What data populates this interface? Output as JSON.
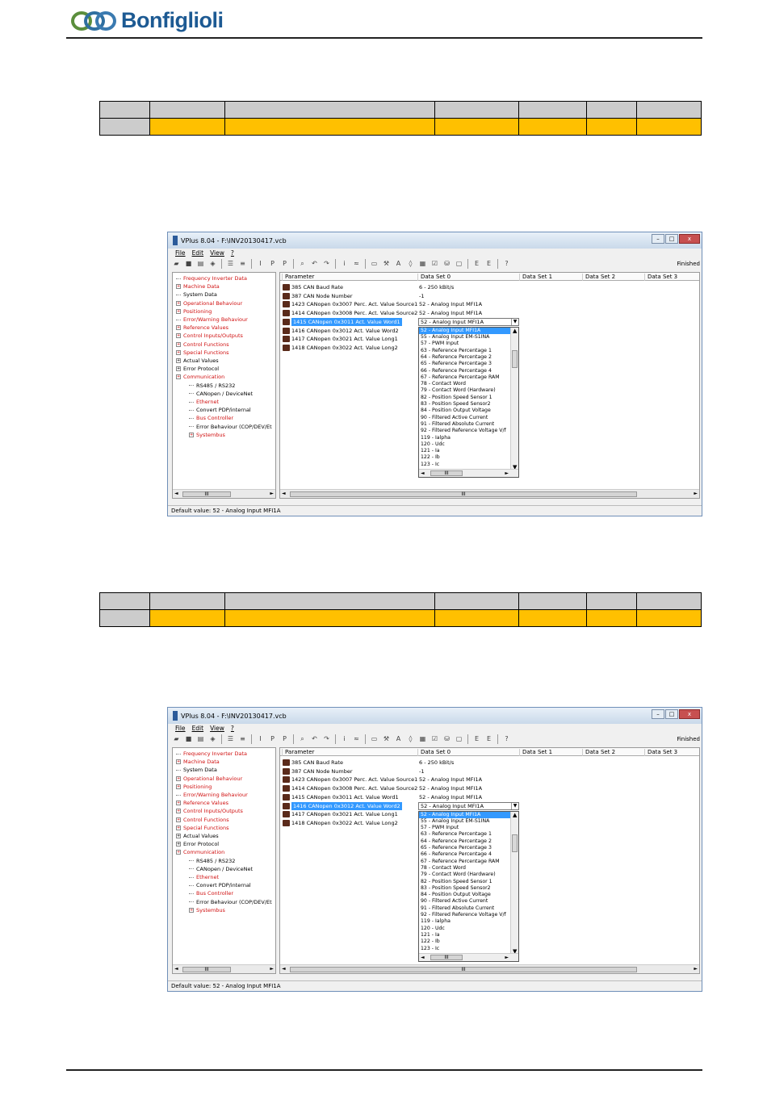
{
  "brand": {
    "name": "Bonfiglioli",
    "colors": {
      "brand": "#1d5a93",
      "highlight": "#ffc000",
      "tableHeader": "#cccccc",
      "red": "#d01010",
      "selection": "#3399ff"
    }
  },
  "screens": [
    {
      "title": "VPlus 8.04 - F:\\INV20130417.vcb",
      "menu": [
        "File",
        "Edit",
        "View",
        "?"
      ],
      "status_right": "Finished",
      "tree": [
        {
          "label": "Frequency Inverter Data",
          "red": true,
          "exp": false
        },
        {
          "label": "Machine Data",
          "red": true,
          "exp": true
        },
        {
          "label": "System Data",
          "red": false,
          "exp": false
        },
        {
          "label": "Operational Behaviour",
          "red": true,
          "exp": true
        },
        {
          "label": "Positioning",
          "red": true,
          "exp": true
        },
        {
          "label": "Error/Warning Behaviour",
          "red": true,
          "exp": false
        },
        {
          "label": "Reference Values",
          "red": true,
          "exp": true
        },
        {
          "label": "Control Inputs/Outputs",
          "red": true,
          "exp": true
        },
        {
          "label": "Control Functions",
          "red": true,
          "exp": true
        },
        {
          "label": "Special Functions",
          "red": true,
          "exp": true
        },
        {
          "label": "Actual Values",
          "red": false,
          "exp": true
        },
        {
          "label": "Error Protocol",
          "red": false,
          "exp": true
        },
        {
          "label": "Communication",
          "red": true,
          "exp": true
        },
        {
          "label": "RS485 / RS232",
          "red": false,
          "exp": false,
          "child": true
        },
        {
          "label": "CANopen / DeviceNet",
          "red": false,
          "exp": false,
          "child": true
        },
        {
          "label": "Ethernet",
          "red": true,
          "exp": false,
          "child": true
        },
        {
          "label": "Convert PDP/internal",
          "red": false,
          "exp": false,
          "child": true
        },
        {
          "label": "Bus Controller",
          "red": true,
          "exp": false,
          "child": true
        },
        {
          "label": "Error Behaviour (COP/DEV/Et",
          "red": false,
          "exp": false,
          "child": true
        },
        {
          "label": "Systembus",
          "red": true,
          "exp": true,
          "child": true
        }
      ],
      "columns": [
        "Parameter",
        "Data Set 0",
        "Data Set 1",
        "Data Set 2",
        "Data Set 3"
      ],
      "rows": [
        {
          "name": "385  CAN Baud Rate",
          "value": "6 - 250 kBit/s"
        },
        {
          "name": "387  CAN Node Number",
          "value": "-1"
        },
        {
          "name": "1423  CANopen 0x3007 Perc. Act. Value Source1",
          "value": "52 - Analog Input MFI1A"
        },
        {
          "name": "1414  CANopen 0x3008 Perc. Act. Value Source2",
          "value": "52 - Analog Input MFI1A"
        },
        {
          "name": "1415  CANopen 0x3011 Act. Value Word1",
          "value": "",
          "selected": true,
          "combo": true
        },
        {
          "name": "1416  CANopen 0x3012 Act. Value Word2",
          "value": ""
        },
        {
          "name": "1417  CANopen 0x3021 Act. Value Long1",
          "value": ""
        },
        {
          "name": "1418  CANopen 0x3022 Act. Value Long2",
          "value": ""
        }
      ],
      "combo_value": "52 - Analog Input MFI1A",
      "status": "Default value: 52 - Analog Input MFI1A"
    },
    {
      "title": "VPlus 8.04 - F:\\INV20130417.vcb",
      "menu": [
        "File",
        "Edit",
        "View",
        "?"
      ],
      "status_right": "Finished",
      "tree": [
        {
          "label": "Frequency Inverter Data",
          "red": true,
          "exp": false
        },
        {
          "label": "Machine Data",
          "red": true,
          "exp": true
        },
        {
          "label": "System Data",
          "red": false,
          "exp": false
        },
        {
          "label": "Operational Behaviour",
          "red": true,
          "exp": true
        },
        {
          "label": "Positioning",
          "red": true,
          "exp": true
        },
        {
          "label": "Error/Warning Behaviour",
          "red": true,
          "exp": false
        },
        {
          "label": "Reference Values",
          "red": true,
          "exp": true
        },
        {
          "label": "Control Inputs/Outputs",
          "red": true,
          "exp": true
        },
        {
          "label": "Control Functions",
          "red": true,
          "exp": true
        },
        {
          "label": "Special Functions",
          "red": true,
          "exp": true
        },
        {
          "label": "Actual Values",
          "red": false,
          "exp": true
        },
        {
          "label": "Error Protocol",
          "red": false,
          "exp": true
        },
        {
          "label": "Communication",
          "red": true,
          "exp": true
        },
        {
          "label": "RS485 / RS232",
          "red": false,
          "exp": false,
          "child": true
        },
        {
          "label": "CANopen / DeviceNet",
          "red": false,
          "exp": false,
          "child": true
        },
        {
          "label": "Ethernet",
          "red": true,
          "exp": false,
          "child": true
        },
        {
          "label": "Convert PDP/internal",
          "red": false,
          "exp": false,
          "child": true
        },
        {
          "label": "Bus Controller",
          "red": true,
          "exp": false,
          "child": true
        },
        {
          "label": "Error Behaviour (COP/DEV/Et",
          "red": false,
          "exp": false,
          "child": true
        },
        {
          "label": "Systembus",
          "red": true,
          "exp": true,
          "child": true
        }
      ],
      "columns": [
        "Parameter",
        "Data Set 0",
        "Data Set 1",
        "Data Set 2",
        "Data Set 3"
      ],
      "rows": [
        {
          "name": "385  CAN Baud Rate",
          "value": "6 - 250 kBit/s"
        },
        {
          "name": "387  CAN Node Number",
          "value": "-1"
        },
        {
          "name": "1423  CANopen 0x3007 Perc. Act. Value Source1",
          "value": "52 - Analog Input MFI1A"
        },
        {
          "name": "1414  CANopen 0x3008 Perc. Act. Value Source2",
          "value": "52 - Analog Input MFI1A"
        },
        {
          "name": "1415  CANopen 0x3011 Act. Value Word1",
          "value": "52 - Analog Input MFI1A"
        },
        {
          "name": "1416  CANopen 0x3012 Act. Value Word2",
          "value": "",
          "selected": true,
          "combo": true
        },
        {
          "name": "1417  CANopen 0x3021 Act. Value Long1",
          "value": ""
        },
        {
          "name": "1418  CANopen 0x3022 Act. Value Long2",
          "value": ""
        }
      ],
      "combo_value": "52 - Analog Input MFI1A",
      "status": "Default value: 52 - Analog Input MFI1A"
    }
  ],
  "dropdown_options": [
    "52 - Analog Input MFI1A",
    "55 - Analog Input EM-S1INA",
    "57 - PWM Input",
    "63 - Reference Percentage 1",
    "64 - Reference Percentage 2",
    "65 - Reference Percentage 3",
    "66 - Reference Percentage 4",
    "67 - Reference Percentage RAM",
    "78 - Contact Word",
    "79 - Contact Word (Hardware)",
    "82 - Position Speed Sensor 1",
    "83 - Position Speed Sensor2",
    "84 - Position Output Voltage",
    "90 - Filtered Active Current",
    "91 - Filtered Absolute Current",
    "92 - Filtered Reference Voltage V/f",
    "119 - Ialpha",
    "120 - Udc",
    "121 - Ia",
    "122 - Ib",
    "123 - Ic"
  ],
  "scroll_label": "III",
  "window_buttons": {
    "min": "–",
    "max": "□",
    "close": "x"
  },
  "icons": {
    "expand": "+",
    "collapse": "-",
    "dropdown": "▼",
    "left": "◄",
    "right": "►",
    "up": "▲",
    "down": "▼"
  },
  "toolbar_icons": [
    "open-icon",
    "save-icon",
    "print-icon",
    "find-icon",
    "sep",
    "tree-view-icon",
    "list-view-icon",
    "sep",
    "insert-icon",
    "add-icon",
    "remove-icon",
    "sep",
    "search-icon",
    "undo-icon",
    "redo-icon",
    "sep",
    "info-icon",
    "compare-icon",
    "sep",
    "monitor-icon",
    "tool-icon",
    "graph-icon",
    "param-icon",
    "table-icon",
    "check-icon",
    "device-icon",
    "window-icon",
    "sep",
    "eu-icon",
    "ep-icon",
    "sep",
    "help-icon"
  ]
}
